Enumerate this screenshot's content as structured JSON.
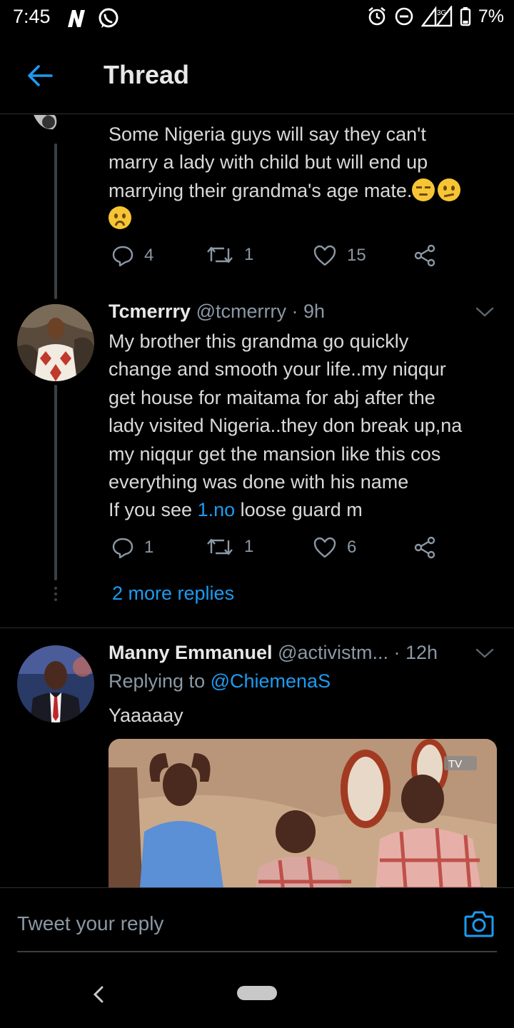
{
  "status_bar": {
    "time": "7:45",
    "battery": "7%",
    "network": "3G",
    "icons_left": [
      "n-app-icon",
      "whatsapp-icon"
    ],
    "icons_right": [
      "alarm-icon",
      "dnd-icon",
      "signal-icon",
      "battery-icon"
    ]
  },
  "header": {
    "title": "Thread",
    "back_icon": "arrow-left-icon"
  },
  "tweets": [
    {
      "text_lines": [
        "Some Nigeria guys will say they can't",
        "marry a lady with child but will end up",
        "marrying their grandma's age mate."
      ],
      "emojis": [
        "unamused-face",
        "confused-face",
        "frowning-face"
      ],
      "replies": "4",
      "retweets": "1",
      "likes": "15"
    },
    {
      "name": "Tcmerrry",
      "handle": "@tcmerrry",
      "time": "· 9h",
      "text_lines": [
        "My brother this grandma go quickly",
        "change and smooth your life..my niqqur",
        "get house for maitama for abj after the",
        "lady visited Nigeria..they don break up,na",
        "my niqqur get the mansion like this cos",
        "everything was done with his name"
      ],
      "last_line_before": "If you see ",
      "last_line_link": "1.no",
      "last_line_after": " loose guard m",
      "replies": "1",
      "retweets": "1",
      "likes": "6",
      "more_replies": "2 more replies"
    },
    {
      "name": "Manny Emmanuel",
      "handle": "@activistm...",
      "time": "· 12h",
      "replying_prefix": "Replying to ",
      "replying_to": "@ChiemenaS",
      "text": "Yaaaaay",
      "media_badge": "TV"
    }
  ],
  "reply_bar": {
    "placeholder": "Tweet your reply"
  },
  "colors": {
    "background": "#000000",
    "accent": "#1d9bf0",
    "text": "#d9d9d9",
    "muted": "#8b98a5"
  }
}
